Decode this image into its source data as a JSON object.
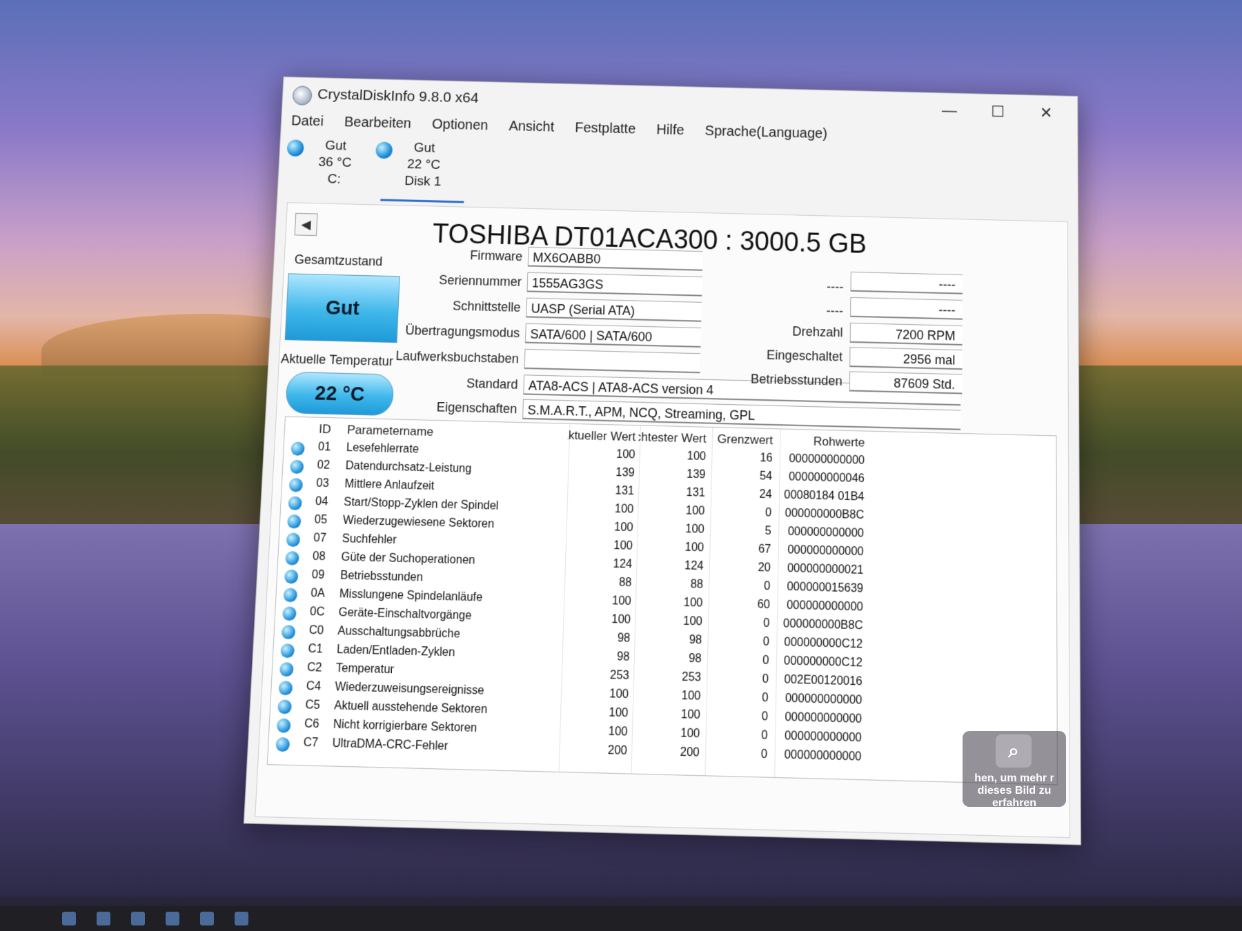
{
  "window": {
    "title": "CrystalDiskInfo 9.8.0 x64",
    "controls": {
      "minimize": "—",
      "maximize": "☐",
      "close": "✕"
    }
  },
  "menu": [
    "Datei",
    "Bearbeiten",
    "Optionen",
    "Ansicht",
    "Festplatte",
    "Hilfe",
    "Sprache(Language)"
  ],
  "disks": [
    {
      "status": "Gut",
      "temp": "36 °C",
      "name": "C:"
    },
    {
      "status": "Gut",
      "temp": "22 °C",
      "name": "Disk 1"
    }
  ],
  "drive": {
    "title": "TOSHIBA DT01ACA300 : 3000.5 GB",
    "health_label": "Gesamtzustand",
    "health": "Gut",
    "temp_label": "Aktuelle Temperatur",
    "temp": "22 °C",
    "fields": {
      "firmware": {
        "label": "Firmware",
        "value": "MX6OABB0"
      },
      "serial": {
        "label": "Seriennummer",
        "value": "1555AG3GS"
      },
      "interface": {
        "label": "Schnittstelle",
        "value": "UASP (Serial ATA)"
      },
      "transfer": {
        "label": "Übertragungsmodus",
        "value": "SATA/600 | SATA/600"
      },
      "letters": {
        "label": "Laufwerksbuchstaben",
        "value": ""
      },
      "standard": {
        "label": "Standard",
        "value": "ATA8-ACS | ATA8-ACS version 4"
      },
      "features": {
        "label": "Eigenschaften",
        "value": "S.M.A.R.T., APM, NCQ, Streaming, GPL"
      }
    },
    "right_fields": {
      "blank1": {
        "label": "----",
        "value": "----"
      },
      "blank2": {
        "label": "----",
        "value": "----"
      },
      "rpm": {
        "label": "Drehzahl",
        "value": "7200 RPM"
      },
      "power_on_count": {
        "label": "Eingeschaltet",
        "value": "2956 mal"
      },
      "power_on_hours": {
        "label": "Betriebsstunden",
        "value": "87609 Std."
      }
    }
  },
  "smart": {
    "headers": {
      "id": "ID",
      "name": "Parametername",
      "current": "Aktueller Wert",
      "worst": "Schlechtester Wert",
      "threshold": "Grenzwert",
      "raw": "Rohwerte"
    },
    "rows": [
      {
        "id": "01",
        "name": "Lesefehlerrate",
        "current": "100",
        "worst": "100",
        "threshold": "16",
        "raw": "000000000000"
      },
      {
        "id": "02",
        "name": "Datendurchsatz-Leistung",
        "current": "139",
        "worst": "139",
        "threshold": "54",
        "raw": "000000000046"
      },
      {
        "id": "03",
        "name": "Mittlere Anlaufzeit",
        "current": "131",
        "worst": "131",
        "threshold": "24",
        "raw": "00080184 01B4"
      },
      {
        "id": "04",
        "name": "Start/Stopp-Zyklen der Spindel",
        "current": "100",
        "worst": "100",
        "threshold": "0",
        "raw": "000000000B8C"
      },
      {
        "id": "05",
        "name": "Wiederzugewiesene Sektoren",
        "current": "100",
        "worst": "100",
        "threshold": "5",
        "raw": "000000000000"
      },
      {
        "id": "07",
        "name": "Suchfehler",
        "current": "100",
        "worst": "100",
        "threshold": "67",
        "raw": "000000000000"
      },
      {
        "id": "08",
        "name": "Güte der Suchoperationen",
        "current": "124",
        "worst": "124",
        "threshold": "20",
        "raw": "000000000021"
      },
      {
        "id": "09",
        "name": "Betriebsstunden",
        "current": "88",
        "worst": "88",
        "threshold": "0",
        "raw": "000000015639"
      },
      {
        "id": "0A",
        "name": "Misslungene Spindelanläufe",
        "current": "100",
        "worst": "100",
        "threshold": "60",
        "raw": "000000000000"
      },
      {
        "id": "0C",
        "name": "Geräte-Einschaltvorgänge",
        "current": "100",
        "worst": "100",
        "threshold": "0",
        "raw": "000000000B8C"
      },
      {
        "id": "C0",
        "name": "Ausschaltungsabbrüche",
        "current": "98",
        "worst": "98",
        "threshold": "0",
        "raw": "000000000C12"
      },
      {
        "id": "C1",
        "name": "Laden/Entladen-Zyklen",
        "current": "98",
        "worst": "98",
        "threshold": "0",
        "raw": "000000000C12"
      },
      {
        "id": "C2",
        "name": "Temperatur",
        "current": "253",
        "worst": "253",
        "threshold": "0",
        "raw": "002E00120016"
      },
      {
        "id": "C4",
        "name": "Wiederzuweisungsereignisse",
        "current": "100",
        "worst": "100",
        "threshold": "0",
        "raw": "000000000000"
      },
      {
        "id": "C5",
        "name": "Aktuell ausstehende Sektoren",
        "current": "100",
        "worst": "100",
        "threshold": "0",
        "raw": "000000000000"
      },
      {
        "id": "C6",
        "name": "Nicht korrigierbare Sektoren",
        "current": "100",
        "worst": "100",
        "threshold": "0",
        "raw": "000000000000"
      },
      {
        "id": "C7",
        "name": "UltraDMA-CRC-Fehler",
        "current": "200",
        "worst": "200",
        "threshold": "0",
        "raw": "000000000000"
      }
    ]
  },
  "lens_hint": {
    "text": "hen, um mehr r dieses Bild zu erfahren"
  },
  "colors": {
    "status_good": "#3fb7ea",
    "accent": "#2f6fd0"
  }
}
